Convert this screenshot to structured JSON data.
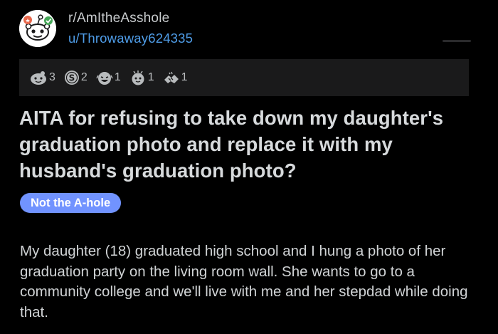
{
  "post": {
    "subreddit": "r/AmItheAsshole",
    "author": "u/Throwaway624335",
    "title": "AITA for refusing to take down my daughter's graduation photo and replace it with my husband's graduation photo?",
    "flair": "Not the A-hole",
    "flair_color": "#7193ff",
    "body": "My daughter (18) graduated high school and I hung a photo of her graduation party on the living room wall. She wants to go to a community college and we'll live with me and her stepdad while doing that."
  },
  "awards": [
    {
      "icon": "wholesome-award-icon",
      "count": "3"
    },
    {
      "icon": "silver-award-icon",
      "count": "2"
    },
    {
      "icon": "laughing-award-icon",
      "count": "1"
    },
    {
      "icon": "face-award-icon",
      "count": "1"
    },
    {
      "icon": "handshake-award-icon",
      "count": "1"
    }
  ],
  "colors": {
    "background": "#000000",
    "awards_bar": "#1a1a1b",
    "username": "#4f9de8",
    "text": "#d7dadc"
  }
}
